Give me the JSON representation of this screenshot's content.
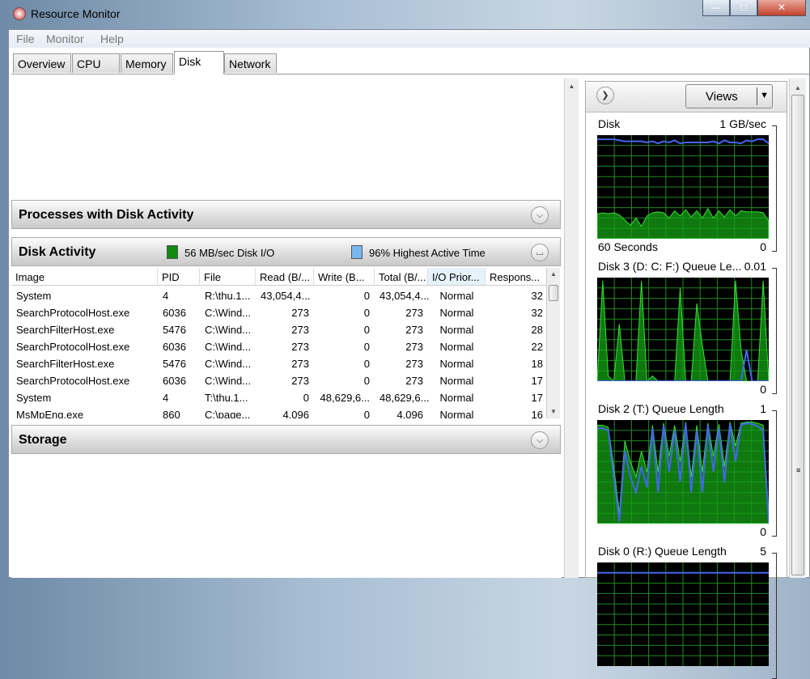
{
  "window": {
    "title": "Resource Monitor",
    "minimize": "—",
    "maximize": "□",
    "close": "✕"
  },
  "menu": [
    "File",
    "Monitor",
    "Help"
  ],
  "tabs": [
    {
      "label": "Overview"
    },
    {
      "label": "CPU"
    },
    {
      "label": "Memory"
    },
    {
      "label": "Disk",
      "active": true
    },
    {
      "label": "Network"
    }
  ],
  "sections": {
    "processes": {
      "title": "Processes with Disk Activity",
      "icon": "chevron-down-icon"
    },
    "disk_activity": {
      "title": "Disk Activity",
      "legend1": "56 MB/sec Disk I/O",
      "legend1_color": "#1aa81a",
      "legend2": "96% Highest Active Time",
      "legend2_color": "#79b7f0",
      "icon": "chevron-up-icon"
    },
    "storage": {
      "title": "Storage",
      "icon": "chevron-down-icon"
    }
  },
  "table": {
    "columns": [
      "Image",
      "PID",
      "File",
      "Read (B/...",
      "Write (B...",
      "Total (B/...",
      "I/O Prior...",
      "Respons..."
    ],
    "rows": [
      [
        "System",
        "4",
        "R:\\thu.1...",
        "43,054,4...",
        "0",
        "43,054,4...",
        "Normal",
        "32"
      ],
      [
        "SearchProtocolHost.exe",
        "6036",
        "C:\\Wind...",
        "273",
        "0",
        "273",
        "Normal",
        "32"
      ],
      [
        "SearchFilterHost.exe",
        "5476",
        "C:\\Wind...",
        "273",
        "0",
        "273",
        "Normal",
        "28"
      ],
      [
        "SearchProtocolHost.exe",
        "6036",
        "C:\\Wind...",
        "273",
        "0",
        "273",
        "Normal",
        "22"
      ],
      [
        "SearchFilterHost.exe",
        "5476",
        "C:\\Wind...",
        "273",
        "0",
        "273",
        "Normal",
        "18"
      ],
      [
        "SearchProtocolHost.exe",
        "6036",
        "C:\\Wind...",
        "273",
        "0",
        "273",
        "Normal",
        "17"
      ],
      [
        "System",
        "4",
        "T:\\thu.1...",
        "0",
        "48,629,6...",
        "48,629,6...",
        "Normal",
        "17"
      ],
      [
        "MsMpEng.exe",
        "860",
        "C:\\page...",
        "4,096",
        "0",
        "4,096",
        "Normal",
        "16"
      ]
    ]
  },
  "right_panel": {
    "views_label": "Views",
    "graphs": [
      {
        "title": "Disk",
        "max": "1 GB/sec",
        "footer_left": "60 Seconds",
        "footer_right": "0",
        "blue": [
          0.96,
          0.96,
          0.96,
          0.96,
          0.95,
          0.94,
          0.94,
          0.94,
          0.94,
          0.93,
          0.94,
          0.92,
          0.94,
          0.93,
          0.95,
          0.92,
          0.93,
          0.93,
          0.93,
          0.93,
          0.93,
          0.94,
          0.92,
          0.95,
          0.93,
          0.93,
          0.92,
          0.95,
          0.94,
          0.96,
          0.96,
          0.92
        ],
        "green": [
          0.24,
          0.25,
          0.24,
          0.25,
          0.23,
          0.18,
          0.13,
          0.2,
          0.12,
          0.22,
          0.25,
          0.26,
          0.25,
          0.2,
          0.27,
          0.22,
          0.28,
          0.21,
          0.27,
          0.2,
          0.29,
          0.2,
          0.27,
          0.21,
          0.28,
          0.22,
          0.27,
          0.26,
          0.26,
          0.26,
          0.25,
          0.17
        ]
      },
      {
        "title": "Disk 3 (D: C: F:) Queue Le...",
        "max": "0.01",
        "footer_right": "0",
        "blue": [
          0,
          0,
          0,
          0,
          0,
          0,
          0,
          0,
          0,
          0,
          0,
          0,
          0,
          0,
          0,
          0,
          0,
          0,
          0,
          0,
          0,
          0,
          0,
          0,
          0,
          0,
          0,
          0.3,
          0,
          0,
          0,
          0
        ],
        "green": [
          0,
          0.97,
          0.05,
          0,
          0.55,
          0,
          0,
          0,
          0.97,
          0,
          0.05,
          0,
          0,
          0,
          0,
          0.9,
          0,
          0,
          0.75,
          0.35,
          0,
          0,
          0,
          0,
          0,
          0.97,
          0.3,
          0,
          0,
          0,
          0.97,
          0
        ]
      },
      {
        "title": "Disk 2 (T:) Queue Length",
        "max": "1",
        "footer_right": "0",
        "blue": [
          0.92,
          0.92,
          0.9,
          0.45,
          0.02,
          0.7,
          0.45,
          0.3,
          0.55,
          0.35,
          0.92,
          0.3,
          0.95,
          0.5,
          0.9,
          0.4,
          0.97,
          0.3,
          0.9,
          0.3,
          0.95,
          0.5,
          0.92,
          0.4,
          0.96,
          0.6,
          0.95,
          0.97,
          0.96,
          0.94,
          0.9,
          0.0
        ],
        "green": [
          0.95,
          0.95,
          0.93,
          0.55,
          0.1,
          0.8,
          0.6,
          0.45,
          0.7,
          0.5,
          0.95,
          0.5,
          0.97,
          0.65,
          0.95,
          0.6,
          0.98,
          0.45,
          0.95,
          0.5,
          0.97,
          0.65,
          0.96,
          0.55,
          0.98,
          0.75,
          0.97,
          0.98,
          0.98,
          0.97,
          0.95,
          0.1
        ]
      },
      {
        "title": "Disk 0 (R:) Queue Length",
        "max": "5",
        "blue": [
          0.9,
          0.9,
          0.9,
          0.9,
          0.9,
          0.9,
          0.9,
          0.9,
          0.9,
          0.9,
          0.9,
          0.9,
          0.9,
          0.9,
          0.9,
          0.9
        ],
        "green": []
      }
    ]
  }
}
